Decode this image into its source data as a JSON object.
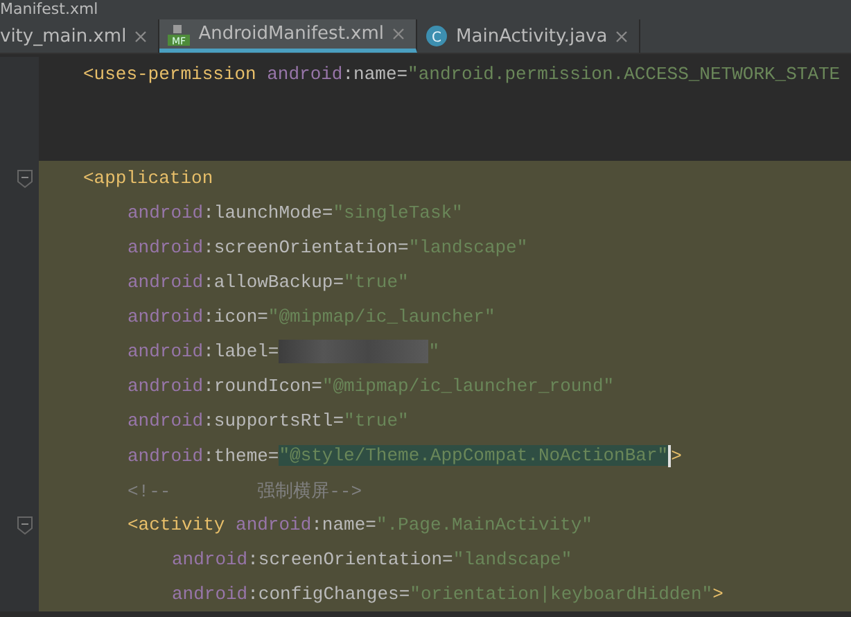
{
  "window": {
    "title": "Manifest.xml"
  },
  "tabs": [
    {
      "label": "vity_main.xml",
      "kind": "xml",
      "selected": false
    },
    {
      "label": "AndroidManifest.xml",
      "kind": "manifest",
      "badge": "MF",
      "selected": true
    },
    {
      "label": "MainActivity.java",
      "kind": "class",
      "badge": "C",
      "selected": false
    }
  ],
  "editor": {
    "lines": [
      {
        "highlighted": false,
        "tokens": [
          {
            "kind": "tag",
            "text": "<uses-permission "
          },
          {
            "kind": "ns",
            "text": "android"
          },
          {
            "kind": "attr",
            "text": ":name="
          },
          {
            "kind": "value",
            "text": "\"android.permission.ACCESS_NETWORK_STATE"
          }
        ]
      },
      {
        "highlighted": false
      },
      {
        "highlighted": false
      },
      {
        "highlighted": true,
        "tokens": [
          {
            "kind": "tag",
            "text": "<application"
          }
        ],
        "children": [
          {
            "highlighted": true,
            "tokens": [
              {
                "kind": "ns",
                "text": "android"
              },
              {
                "kind": "attr",
                "text": ":launchMode="
              },
              {
                "kind": "value",
                "text": "\"singleTask\""
              }
            ]
          },
          {
            "highlighted": true,
            "tokens": [
              {
                "kind": "ns",
                "text": "android"
              },
              {
                "kind": "attr",
                "text": ":screenOrientation="
              },
              {
                "kind": "value",
                "text": "\"landscape\""
              }
            ]
          },
          {
            "highlighted": true,
            "tokens": [
              {
                "kind": "ns",
                "text": "android"
              },
              {
                "kind": "attr",
                "text": ":allowBackup="
              },
              {
                "kind": "value",
                "text": "\"true\""
              }
            ]
          },
          {
            "highlighted": true,
            "tokens": [
              {
                "kind": "ns",
                "text": "android"
              },
              {
                "kind": "attr",
                "text": ":icon="
              },
              {
                "kind": "value",
                "text": "\"@mipmap/ic_launcher\""
              }
            ]
          },
          {
            "highlighted": true,
            "tokens": [
              {
                "kind": "ns",
                "text": "android"
              },
              {
                "kind": "attr",
                "text": ":label="
              },
              {
                "kind": "redacted"
              },
              {
                "kind": "value",
                "text": "\""
              }
            ]
          },
          {
            "highlighted": true,
            "tokens": [
              {
                "kind": "ns",
                "text": "android"
              },
              {
                "kind": "attr",
                "text": ":roundIcon="
              },
              {
                "kind": "value",
                "text": "\"@mipmap/ic_launcher_round\""
              }
            ]
          },
          {
            "highlighted": true,
            "tokens": [
              {
                "kind": "ns",
                "text": "android"
              },
              {
                "kind": "attr",
                "text": ":supportsRtl="
              },
              {
                "kind": "value",
                "text": "\"true\""
              }
            ]
          },
          {
            "highlighted": true,
            "tokens": [
              {
                "kind": "ns",
                "text": "android"
              },
              {
                "kind": "attr",
                "text": ":theme="
              },
              {
                "kind": "value",
                "text": "\"@style/Theme.AppCompat.NoActionBar\"",
                "selected": true,
                "caret": true
              },
              {
                "kind": "tag",
                "text": ">"
              }
            ]
          },
          {
            "highlighted": true,
            "tokens": [
              {
                "kind": "comment",
                "text": "<!--        强制横屏-->"
              }
            ]
          },
          {
            "highlighted": true,
            "tokens": [
              {
                "kind": "tag",
                "text": "<activity "
              },
              {
                "kind": "ns",
                "text": "android"
              },
              {
                "kind": "attr",
                "text": ":name="
              },
              {
                "kind": "value",
                "text": "\".Page.MainActivity\""
              }
            ],
            "children": [
              {
                "highlighted": true,
                "tokens": [
                  {
                    "kind": "ns",
                    "text": "android"
                  },
                  {
                    "kind": "attr",
                    "text": ":screenOrientation="
                  },
                  {
                    "kind": "value",
                    "text": "\"landscape\""
                  }
                ]
              },
              {
                "highlighted": true,
                "tokens": [
                  {
                    "kind": "ns",
                    "text": "android"
                  },
                  {
                    "kind": "attr",
                    "text": ":configChanges="
                  },
                  {
                    "kind": "value",
                    "text": "\"orientation|keyboardHidden\""
                  },
                  {
                    "kind": "tag",
                    "text": ">"
                  }
                ]
              }
            ]
          }
        ]
      }
    ]
  }
}
